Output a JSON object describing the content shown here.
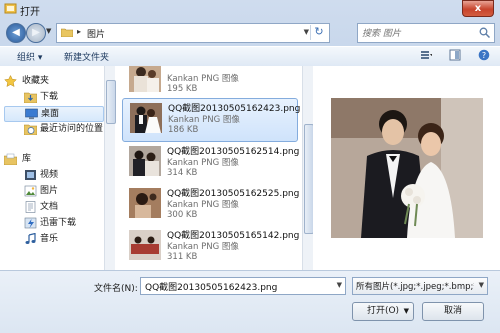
{
  "window": {
    "title": "打开",
    "close_label": "x"
  },
  "address": {
    "crumb": "图片",
    "separator": "▸"
  },
  "search": {
    "placeholder": "搜索 图片"
  },
  "toolbar": {
    "organize": "组织 ▾",
    "new_folder": "新建文件夹"
  },
  "nav": {
    "favorites": "收藏夹",
    "downloads": "下载",
    "desktop": "桌面",
    "recent": "最近访问的位置",
    "libraries": "库",
    "videos": "视频",
    "pictures": "图片",
    "documents": "文档",
    "thunder": "迅雷下载",
    "music": "音乐"
  },
  "files": [
    {
      "name": "",
      "type": "Kankan PNG 图像",
      "size": "195 KB",
      "selected": false
    },
    {
      "name": "QQ截图20130505162423.png",
      "type": "Kankan PNG 图像",
      "size": "186 KB",
      "selected": true
    },
    {
      "name": "QQ截图20130505162514.png",
      "type": "Kankan PNG 图像",
      "size": "314 KB",
      "selected": false
    },
    {
      "name": "QQ截图20130505162525.png",
      "type": "Kankan PNG 图像",
      "size": "300 KB",
      "selected": false
    },
    {
      "name": "QQ截图20130505165142.png",
      "type": "Kankan PNG 图像",
      "size": "311 KB",
      "selected": false
    }
  ],
  "bottom": {
    "filename_label": "文件名(N):",
    "filename_value": "QQ截图20130505162423.png",
    "filetype_value": "所有图片(*.jpg;*.jpeg;*.bmp;*.",
    "open_label": "打开(O)",
    "cancel_label": "取消"
  }
}
